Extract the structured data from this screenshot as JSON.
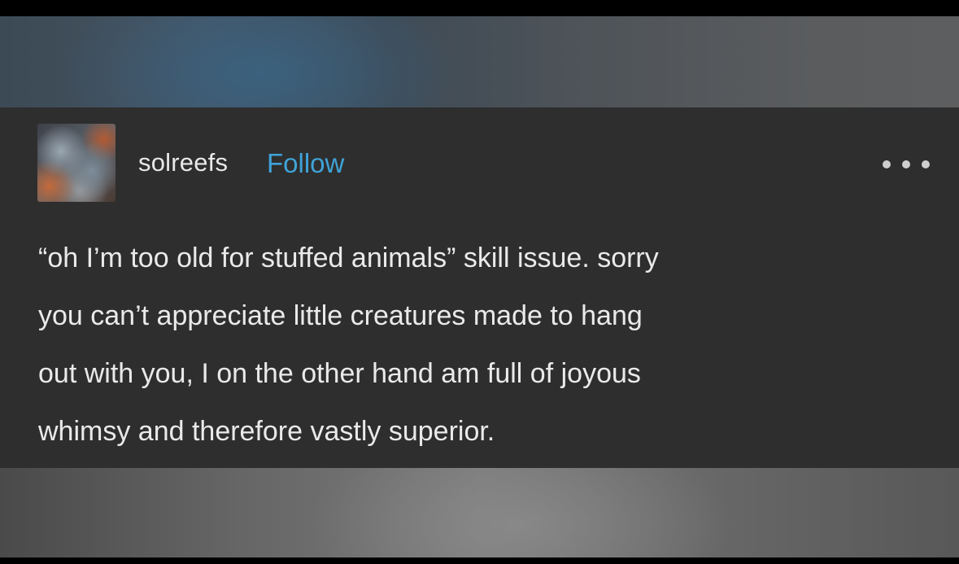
{
  "post": {
    "username": "solreefs",
    "follow_label": "Follow",
    "body_lines": [
      "“oh I’m too old for stuffed animals” skill issue. sorry",
      "you can’t appreciate little creatures made to hang",
      "out with you, I on the other hand am full of joyous",
      "whimsy and therefore vastly superior."
    ]
  },
  "icons": {
    "avatar": "user-avatar",
    "more": "more-options-icon"
  },
  "colors": {
    "card_background": "#2e2e2e",
    "follow_link": "#3fa3d8",
    "text": "#eaeaea"
  }
}
